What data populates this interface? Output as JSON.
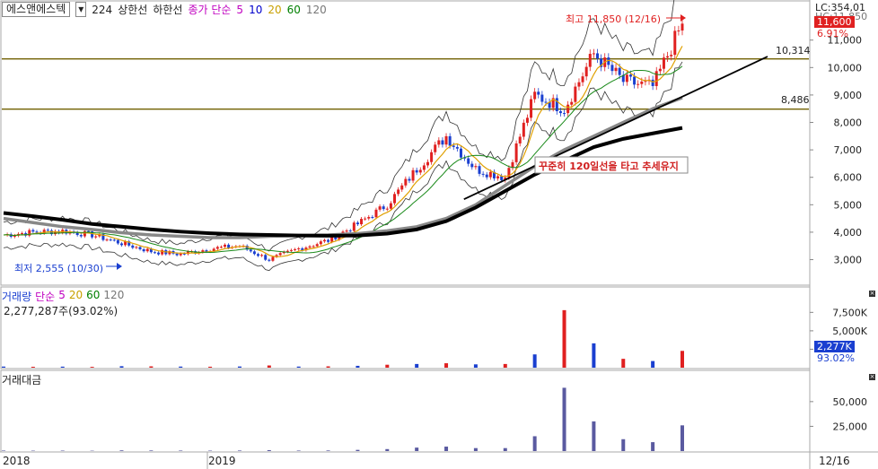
{
  "header": {
    "stock_name": "에스앤에스텍",
    "code": "224",
    "upper_limit_label": "상한선",
    "lower_limit_label": "하한선",
    "ma_label": "종가 단순",
    "ma_periods": [
      "5",
      "10",
      "20",
      "60",
      "120"
    ]
  },
  "top_right": {
    "lc": "LC:354,01",
    "hc": "HC:11,850"
  },
  "price_badge": {
    "value": "11,600",
    "pct": "6.91%",
    "color": "#e02020"
  },
  "annotations": {
    "high": "최고 11,850 (12/16)",
    "low": "최저 2,555 (10/30)",
    "trend": "꾸준히 120일선을 타고 추세유지",
    "level_upper": "10,314",
    "level_lower": "8,486"
  },
  "volume_panel": {
    "title": "거래량",
    "ma_label": "단순",
    "ma_periods": [
      "5",
      "20",
      "60",
      "120"
    ],
    "current": "2,277,287주(93.02%)",
    "badge_value": "2,277K",
    "badge_pct": "93.02%"
  },
  "amount_panel": {
    "title": "거래대금"
  },
  "x_axis": {
    "labels": [
      "2018",
      "2019",
      "12/16"
    ]
  },
  "colors": {
    "up": "#e02020",
    "down": "#1a3fd0",
    "bar": "#5a5aa0",
    "level": "#706000"
  },
  "chart_data": [
    {
      "type": "line",
      "name": "price",
      "y_ticks": [
        3000,
        4000,
        5000,
        6000,
        7000,
        8000,
        9000,
        10000,
        11000
      ],
      "ylim": [
        2200,
        12200
      ],
      "x": [
        "2018-01",
        "2018-02",
        "2018-03",
        "2018-04",
        "2018-05",
        "2018-06",
        "2018-07",
        "2018-08",
        "2018-09",
        "2018-10",
        "2018-11",
        "2018-12",
        "2019-01",
        "2019-02",
        "2019-03",
        "2019-04",
        "2019-05",
        "2019-06",
        "2019-07",
        "2019-08",
        "2019-09",
        "2019-10",
        "2019-11",
        "2019-12"
      ],
      "series": [
        {
          "values": [
            3900,
            4000,
            4050,
            3900,
            3600,
            3300,
            3200,
            3400,
            3500,
            3000,
            3400,
            3700,
            4300,
            5000,
            6300,
            7500,
            6300,
            6000,
            9000,
            8500,
            10500,
            9500,
            9300,
            11600
          ]
        },
        {
          "values": [
            4500,
            4350,
            4200,
            4100,
            3980,
            3900,
            3850,
            3800,
            3800,
            3850,
            3880,
            3900,
            3950,
            4050,
            4200,
            4500,
            5000,
            5700,
            6400,
            7000,
            7500,
            8000,
            8500,
            8900
          ]
        },
        {
          "values": [
            4700,
            4580,
            4450,
            4300,
            4200,
            4100,
            4020,
            3960,
            3920,
            3900,
            3880,
            3870,
            3880,
            3950,
            4100,
            4400,
            4900,
            5500,
            6100,
            6600,
            7100,
            7400,
            7600,
            7800
          ]
        }
      ],
      "levels": [
        10314,
        8486
      ]
    },
    {
      "type": "bar",
      "name": "volume",
      "y_ticks": [
        2500,
        5000,
        7500
      ],
      "y_tick_labels": [
        "",
        "5,000K",
        "7,500K"
      ],
      "ylim": [
        0,
        9000
      ],
      "x": [
        "2018-01",
        "2018-02",
        "2018-03",
        "2018-04",
        "2018-05",
        "2018-06",
        "2018-07",
        "2018-08",
        "2018-09",
        "2018-10",
        "2018-11",
        "2018-12",
        "2019-01",
        "2019-02",
        "2019-03",
        "2019-04",
        "2019-05",
        "2019-06",
        "2019-07",
        "2019-08",
        "2019-09",
        "2019-10",
        "2019-11",
        "2019-12"
      ],
      "values": [
        150,
        120,
        140,
        110,
        200,
        180,
        150,
        130,
        160,
        300,
        150,
        180,
        250,
        400,
        500,
        600,
        450,
        500,
        1800,
        7800,
        3300,
        1200,
        900,
        2277
      ]
    },
    {
      "type": "bar",
      "name": "amount",
      "y_ticks": [
        25000,
        50000
      ],
      "y_tick_labels": [
        "25,000",
        "50,000"
      ],
      "ylim": [
        0,
        68000
      ],
      "x": [
        "2018-01",
        "2018-02",
        "2018-03",
        "2018-04",
        "2018-05",
        "2018-06",
        "2018-07",
        "2018-08",
        "2018-09",
        "2018-10",
        "2018-11",
        "2018-12",
        "2019-01",
        "2019-02",
        "2019-03",
        "2019-04",
        "2019-05",
        "2019-06",
        "2019-07",
        "2019-08",
        "2019-09",
        "2019-10",
        "2019-11",
        "2019-12"
      ],
      "values": [
        500,
        400,
        450,
        350,
        700,
        600,
        500,
        450,
        550,
        900,
        500,
        600,
        1200,
        2000,
        3500,
        4500,
        3000,
        3000,
        15000,
        64000,
        30000,
        12000,
        9000,
        26000
      ]
    }
  ]
}
